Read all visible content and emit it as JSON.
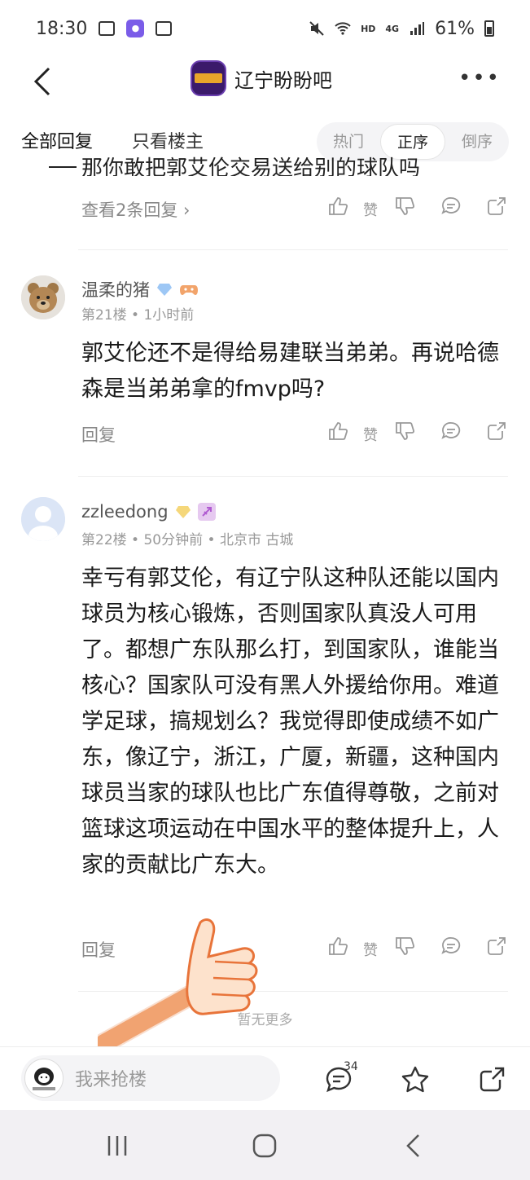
{
  "status_bar": {
    "time": "18:30",
    "network": "HD",
    "signal_type": "4G",
    "battery": "61%"
  },
  "nav": {
    "forum_title": "辽宁盼盼吧"
  },
  "tabs": {
    "all": "全部回复",
    "op_only": "只看楼主"
  },
  "sort": {
    "options": [
      "热门",
      "正序",
      "倒序"
    ],
    "active": "正序"
  },
  "prev_comment": {
    "cutoff_text": "那你敢把郭艾伦交易送给别的球队吗",
    "view_replies": "查看2条回复"
  },
  "actions": {
    "like_label": "赞",
    "reply_label": "回复"
  },
  "comments": [
    {
      "username": "温柔的猪",
      "floor": "第21楼",
      "time": "1小时前",
      "location": "",
      "text": "郭艾伦还不是得给易建联当弟弟。再说哈德森是当弟弟拿的fmvp吗?"
    },
    {
      "username": "zzleedong",
      "floor": "第22楼",
      "time": "50分钟前",
      "location": "北京市 古城",
      "text": "幸亏有郭艾伦，有辽宁队这种队还能以国内球员为核心锻炼，否则国家队真没人可用了。都想广东队那么打，到国家队，谁能当核心？国家队可没有黑人外援给你用。难道学足球，搞规划么？我觉得即使成绩不如广东，像辽宁，浙江，广厦，新疆，这种国内球员当家的球队也比广东值得尊敬，之前对篮球这项运动在中国水平的整体提升上，人家的贡献比广东大。"
    }
  ],
  "meta_separator": "•",
  "no_more": "暂无更多",
  "bottom_bar": {
    "input_placeholder": "我来抢楼",
    "comment_count": "34"
  },
  "colors": {
    "accent_purple": "#7a5ce8",
    "text_gray": "#888888",
    "divider": "#eeeeee"
  }
}
